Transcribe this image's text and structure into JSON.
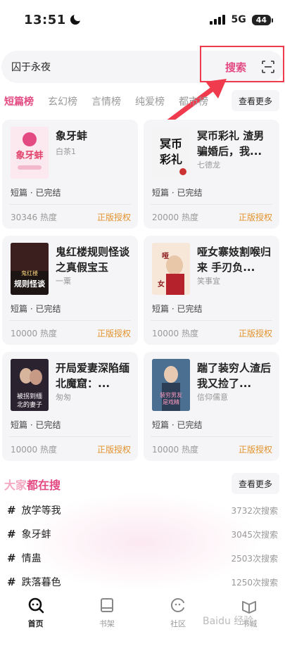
{
  "status_bar": {
    "time": "13:51",
    "network": "5G",
    "battery": "44"
  },
  "search": {
    "query": "囚于永夜",
    "button_label": "搜索"
  },
  "tabs": [
    {
      "label": "短篇榜",
      "active": true
    },
    {
      "label": "玄幻榜"
    },
    {
      "label": "言情榜"
    },
    {
      "label": "纯爱榜"
    },
    {
      "label": "都市榜"
    }
  ],
  "tabs_more": "查看更多",
  "books": [
    {
      "title": "象牙蚌",
      "author": "白茶1",
      "meta": "短篇 · 已完结",
      "heat": "30346 热度",
      "license": "正版授权",
      "cover_text": "象牙蚌",
      "cover_bg": "#fbe9ef"
    },
    {
      "title": "冥币彩礼 渣男骗婚后，我...",
      "author": "七德龙",
      "meta": "短篇 · 已完结",
      "heat": "20000 热度",
      "license": "正版授权",
      "cover_text": "冥币彩礼",
      "cover_bg": "#f2f2f2"
    },
    {
      "title": "鬼红楼规则怪谈之真假宝玉",
      "author": "一粟",
      "meta": "短篇 · 已完结",
      "heat": "10000 热度",
      "license": "正版授权",
      "cover_text": "规则怪谈",
      "cover_bg": "#2a1a1a"
    },
    {
      "title": "哑女寨妓割喉归来 手刃负...",
      "author": "笑事宜",
      "meta": "短篇 · 已完结",
      "heat": "10000 热度",
      "license": "正版授权",
      "cover_text": "哑女",
      "cover_bg": "#f6e7d9"
    },
    {
      "title": "开局爱妻深陷缅北魔窟：...",
      "author": "匆匆",
      "meta": "短篇 · 已完结",
      "heat": "10000 热度",
      "license": "正版授权",
      "cover_text": "被拐到缅北的妻子",
      "cover_bg": "#2b2230"
    },
    {
      "title": "踹了装穷人渣后 我又捡了...",
      "author": "信仰儒意",
      "meta": "短篇 · 已完结",
      "heat": "10000 热度",
      "license": "正版授权",
      "cover_text": "装穷男友是戏精",
      "cover_bg": "#3a5a7a"
    }
  ],
  "trending": {
    "title_light": "大家",
    "title_strong": "都在搜",
    "more": "查看更多",
    "items": [
      {
        "label": "放学等我",
        "count": "3732次搜索"
      },
      {
        "label": "象牙蚌",
        "count": "3045次搜索"
      },
      {
        "label": "情蛊",
        "count": "2503次搜索"
      },
      {
        "label": "跌落暮色",
        "count": "1250次搜索"
      }
    ]
  },
  "nav": [
    {
      "label": "首页",
      "icon": "home-icon",
      "active": true
    },
    {
      "label": "书架",
      "icon": "bookshelf-icon"
    },
    {
      "label": "社区",
      "icon": "community-icon"
    },
    {
      "label": "书城",
      "icon": "bookstore-icon"
    }
  ],
  "watermark": "Baidu 经验",
  "colors": {
    "accent": "#e34a82",
    "license": "#e3922d",
    "highlight": "#ef3b4d"
  }
}
